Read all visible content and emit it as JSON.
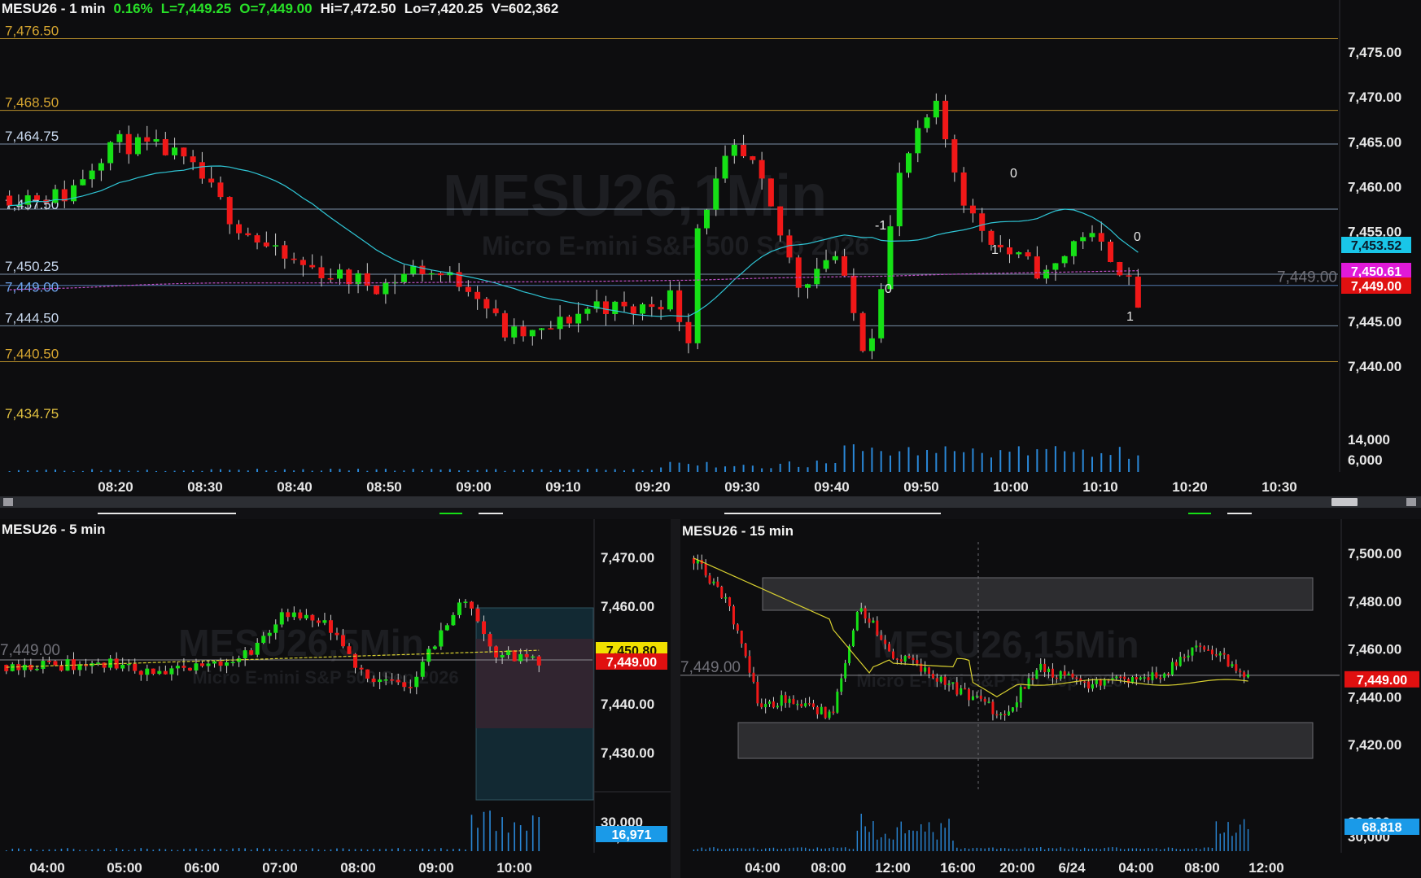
{
  "colors": {
    "bg": "#0d0d0f",
    "up": "#16e016",
    "down": "#f01818",
    "grid": "#3a3a40",
    "level_blue": "#a9c8e8",
    "level_gold": "#d5a530",
    "ema_cyan": "#2fc6d6",
    "vwap_magenta": "#c050c8",
    "yellow_ma": "#d8d030",
    "volume": "#2a88d8",
    "badge_cyan": "#19c6e8",
    "badge_magenta": "#e01ad8",
    "badge_red": "#e01010",
    "badge_yellow": "#f0e000",
    "badge_blue": "#1a9ae8"
  },
  "main": {
    "header": {
      "symbol": "MESU26 - 1 min",
      "change": "0.16%",
      "last": "L=7,449.25",
      "open": "O=7,449.00",
      "high": "Hi=7,472.50",
      "low": "Lo=7,420.25",
      "volume": "V=602,362"
    },
    "watermark": {
      "title": "MESU26,1Min",
      "subtitle": "Micro E-mini S&P 500 Sep 2026"
    },
    "levels": [
      {
        "label": "7,476.50",
        "price": 7476.5,
        "kind": "gold"
      },
      {
        "label": "7,468.50",
        "price": 7468.5,
        "kind": "gold"
      },
      {
        "label": "7,464.75",
        "price": 7464.75,
        "kind": "blue"
      },
      {
        "label": "7,457.50",
        "price": 7457.5,
        "kind": "blue"
      },
      {
        "label": "7,450.25",
        "price": 7450.25,
        "kind": "blue"
      },
      {
        "label": "7,449.00",
        "price": 7449.0,
        "kind": "lightblue"
      },
      {
        "label": "7,444.50",
        "price": 7444.5,
        "kind": "blue"
      },
      {
        "label": "7,440.50",
        "price": 7440.5,
        "kind": "gold"
      },
      {
        "label": "7,434.75",
        "price": 7434.75,
        "kind": "goldtext"
      }
    ],
    "price_axis": [
      "7,475.00",
      "7,470.00",
      "7,465.00",
      "7,460.00",
      "7,455.00",
      "7,450.00",
      "7,445.00",
      "7,440.00"
    ],
    "price_axis_values": [
      7475,
      7470,
      7465,
      7460,
      7455,
      7450,
      7445,
      7440
    ],
    "volume_axis": [
      "14,000",
      "6,000"
    ],
    "volume_axis_values": [
      14000,
      6000
    ],
    "time_axis": [
      "08:20",
      "08:30",
      "08:40",
      "08:50",
      "09:00",
      "09:10",
      "09:20",
      "09:30",
      "09:40",
      "09:50",
      "10:00",
      "10:10",
      "10:20",
      "10:30"
    ],
    "badges": [
      {
        "text": "7,453.52",
        "price": 7453.52,
        "color": "badge_cyan"
      },
      {
        "text": "7,450.61",
        "price": 7450.61,
        "color": "badge_magenta"
      },
      {
        "text": "7,449.00",
        "price": 7449.0,
        "color": "badge_red"
      }
    ],
    "last_price_ghost": "7,449.00",
    "markers": [
      "0",
      "-1",
      "0",
      "1",
      "0",
      "1",
      "1"
    ]
  },
  "bottom_left": {
    "header": "MESU26 - 5 min",
    "watermark": {
      "title": "MESU26,5Min",
      "subtitle": "Micro E-mini S&P 500 Sep 2026"
    },
    "price_axis": [
      "7,470.00",
      "7,460.00",
      "7,450.00",
      "7,440.00",
      "7,430.00"
    ],
    "price_axis_values": [
      7470,
      7460,
      7450,
      7440,
      7430
    ],
    "volume_axis": [
      "30,000",
      "10,000"
    ],
    "time_axis": [
      "04:00",
      "05:00",
      "06:00",
      "07:00",
      "08:00",
      "09:00",
      "10:00"
    ],
    "ghost_price": "7,449.00",
    "badges": [
      {
        "text": "7,450.80",
        "price": 7450.8,
        "color": "badge_yellow"
      },
      {
        "text": "7,449.00",
        "price": 7449.0,
        "color": "badge_red"
      }
    ],
    "volume_badge": "16,971"
  },
  "bottom_right": {
    "header": "MESU26 - 15 min",
    "watermark": {
      "title": "MESU26,15Min",
      "subtitle": "Micro E-mini S&P 500 Sep 2026"
    },
    "price_axis": [
      "7,500.00",
      "7,480.00",
      "7,460.00",
      "7,440.00",
      "7,420.00"
    ],
    "price_axis_values": [
      7500,
      7480,
      7460,
      7440,
      7420
    ],
    "volume_axis": [
      "90,000",
      "30,000"
    ],
    "time_axis": [
      "04:00",
      "08:00",
      "12:00",
      "16:00",
      "20:00",
      "6/24",
      "04:00",
      "08:00",
      "12:00"
    ],
    "ghost_price": "7,449.00",
    "badges": [
      {
        "text": "7,449.00",
        "price": 7449.0,
        "color": "badge_red"
      }
    ],
    "volume_badge": "68,818"
  }
}
